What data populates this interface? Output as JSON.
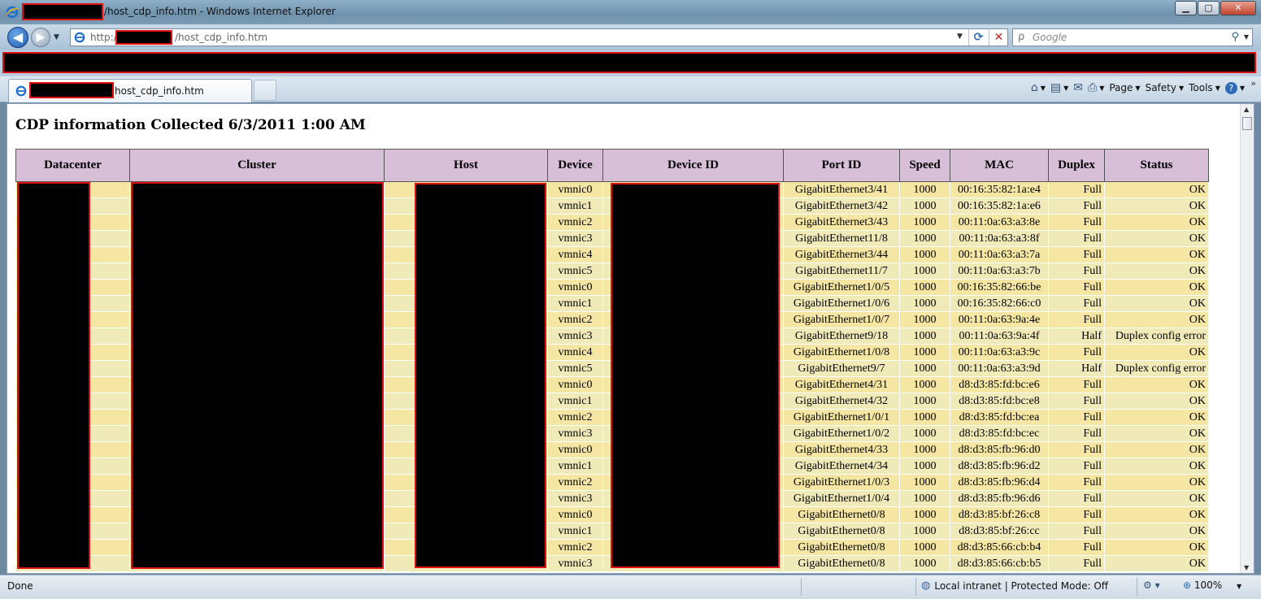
{
  "window": {
    "title_suffix": "/host_cdp_info.htm - Windows Internet Explorer",
    "minimize": "▁",
    "maximize": "▢",
    "close": "✕"
  },
  "address": {
    "prefix": "http://",
    "path": "/host_cdp_info.htm"
  },
  "search": {
    "placeholder": "Google"
  },
  "tab": {
    "title_suffix": "host_cdp_info.htm"
  },
  "commands": {
    "page": "Page",
    "safety": "Safety",
    "tools": "Tools",
    "help": "?"
  },
  "page": {
    "title": "CDP information Collected 6/3/2011 1:00 AM"
  },
  "table": {
    "headers": [
      "Datacenter",
      "Cluster",
      "Host",
      "Device",
      "Device ID",
      "Port ID",
      "Speed",
      "MAC",
      "Duplex",
      "Status"
    ],
    "rows": [
      {
        "device": "vmnic0",
        "port": "GigabitEthernet3/41",
        "speed": "1000",
        "mac": "00:16:35:82:1a:e4",
        "duplex": "Full",
        "status": "OK"
      },
      {
        "device": "vmnic1",
        "port": "GigabitEthernet3/42",
        "speed": "1000",
        "mac": "00:16:35:82:1a:e6",
        "duplex": "Full",
        "status": "OK"
      },
      {
        "device": "vmnic2",
        "port": "GigabitEthernet3/43",
        "speed": "1000",
        "mac": "00:11:0a:63:a3:8e",
        "duplex": "Full",
        "status": "OK"
      },
      {
        "device": "vmnic3",
        "port": "GigabitEthernet11/8",
        "speed": "1000",
        "mac": "00:11:0a:63:a3:8f",
        "duplex": "Full",
        "status": "OK"
      },
      {
        "device": "vmnic4",
        "port": "GigabitEthernet3/44",
        "speed": "1000",
        "mac": "00:11:0a:63:a3:7a",
        "duplex": "Full",
        "status": "OK"
      },
      {
        "device": "vmnic5",
        "port": "GigabitEthernet11/7",
        "speed": "1000",
        "mac": "00:11:0a:63:a3:7b",
        "duplex": "Full",
        "status": "OK"
      },
      {
        "device": "vmnic0",
        "port": "GigabitEthernet1/0/5",
        "speed": "1000",
        "mac": "00:16:35:82:66:be",
        "duplex": "Full",
        "status": "OK"
      },
      {
        "device": "vmnic1",
        "port": "GigabitEthernet1/0/6",
        "speed": "1000",
        "mac": "00:16:35:82:66:c0",
        "duplex": "Full",
        "status": "OK"
      },
      {
        "device": "vmnic2",
        "port": "GigabitEthernet1/0/7",
        "speed": "1000",
        "mac": "00:11:0a:63:9a:4e",
        "duplex": "Full",
        "status": "OK"
      },
      {
        "device": "vmnic3",
        "port": "GigabitEthernet9/18",
        "speed": "1000",
        "mac": "00:11:0a:63:9a:4f",
        "duplex": "Half",
        "status": "Duplex config error"
      },
      {
        "device": "vmnic4",
        "port": "GigabitEthernet1/0/8",
        "speed": "1000",
        "mac": "00:11:0a:63:a3:9c",
        "duplex": "Full",
        "status": "OK"
      },
      {
        "device": "vmnic5",
        "port": "GigabitEthernet9/7",
        "speed": "1000",
        "mac": "00:11:0a:63:a3:9d",
        "duplex": "Half",
        "status": "Duplex config error"
      },
      {
        "device": "vmnic0",
        "port": "GigabitEthernet4/31",
        "speed": "1000",
        "mac": "d8:d3:85:fd:bc:e6",
        "duplex": "Full",
        "status": "OK"
      },
      {
        "device": "vmnic1",
        "port": "GigabitEthernet4/32",
        "speed": "1000",
        "mac": "d8:d3:85:fd:bc:e8",
        "duplex": "Full",
        "status": "OK"
      },
      {
        "device": "vmnic2",
        "port": "GigabitEthernet1/0/1",
        "speed": "1000",
        "mac": "d8:d3:85:fd:bc:ea",
        "duplex": "Full",
        "status": "OK"
      },
      {
        "device": "vmnic3",
        "port": "GigabitEthernet1/0/2",
        "speed": "1000",
        "mac": "d8:d3:85:fd:bc:ec",
        "duplex": "Full",
        "status": "OK"
      },
      {
        "device": "vmnic0",
        "port": "GigabitEthernet4/33",
        "speed": "1000",
        "mac": "d8:d3:85:fb:96:d0",
        "duplex": "Full",
        "status": "OK"
      },
      {
        "device": "vmnic1",
        "port": "GigabitEthernet4/34",
        "speed": "1000",
        "mac": "d8:d3:85:fb:96:d2",
        "duplex": "Full",
        "status": "OK"
      },
      {
        "device": "vmnic2",
        "port": "GigabitEthernet1/0/3",
        "speed": "1000",
        "mac": "d8:d3:85:fb:96:d4",
        "duplex": "Full",
        "status": "OK"
      },
      {
        "device": "vmnic3",
        "port": "GigabitEthernet1/0/4",
        "speed": "1000",
        "mac": "d8:d3:85:fb:96:d6",
        "duplex": "Full",
        "status": "OK"
      },
      {
        "device": "vmnic0",
        "port": "GigabitEthernet0/8",
        "speed": "1000",
        "mac": "d8:d3:85:bf:26:c8",
        "duplex": "Full",
        "status": "OK"
      },
      {
        "device": "vmnic1",
        "port": "GigabitEthernet0/8",
        "speed": "1000",
        "mac": "d8:d3:85:bf:26:cc",
        "duplex": "Full",
        "status": "OK"
      },
      {
        "device": "vmnic2",
        "port": "GigabitEthernet0/8",
        "speed": "1000",
        "mac": "d8:d3:85:66:cb:b4",
        "duplex": "Full",
        "status": "OK"
      },
      {
        "device": "vmnic3",
        "port": "GigabitEthernet0/8",
        "speed": "1000",
        "mac": "d8:d3:85:66:cb:b5",
        "duplex": "Full",
        "status": "OK"
      }
    ]
  },
  "status": {
    "done": "Done",
    "zone": "Local intranet | Protected Mode: Off",
    "zoom": "100%"
  },
  "icons": {
    "ie": "ie-logo-icon",
    "back": "back-arrow-icon",
    "forward": "forward-arrow-icon",
    "refresh": "refresh-icon",
    "stop": "stop-icon",
    "search": "search-icon",
    "home": "home-icon",
    "feeds": "rss-feed-icon",
    "mail": "mail-icon",
    "print": "printer-icon",
    "help": "help-icon",
    "zone": "intranet-globe-icon",
    "zoom": "zoom-icon"
  },
  "colors": {
    "header_bg": "#d8bfd8",
    "row_odd": "#f5e6a3",
    "row_even": "#f0eab9",
    "redaction_border": "#e01010"
  }
}
